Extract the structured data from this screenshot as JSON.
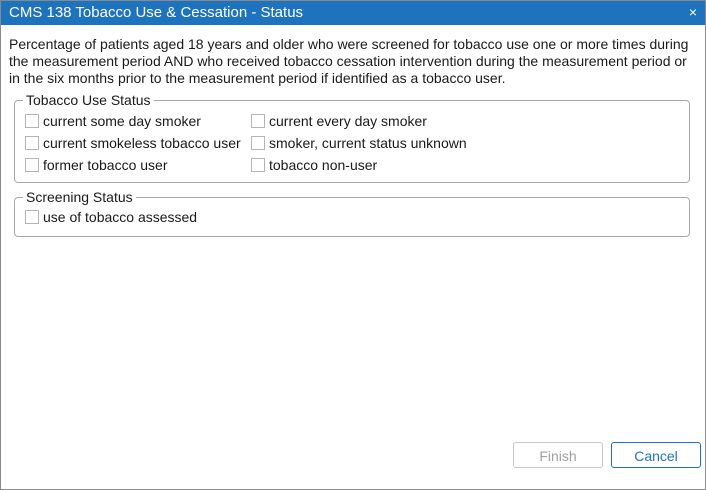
{
  "dialog": {
    "title": "CMS 138 Tobacco Use & Cessation - Status",
    "close_glyph": "×",
    "description": "Percentage of patients aged 18 years and older who were screened for tobacco use one or more times during the measurement period AND who received tobacco cessation intervention during the measurement period or in the six months prior to the measurement period if identified as a tobacco user."
  },
  "tobacco_use_status": {
    "legend": "Tobacco Use Status",
    "options": [
      {
        "label": "current some day smoker",
        "checked": false
      },
      {
        "label": "current every day smoker",
        "checked": false
      },
      {
        "label": "current smokeless tobacco user",
        "checked": false
      },
      {
        "label": "smoker, current status unknown",
        "checked": false
      },
      {
        "label": "former tobacco user",
        "checked": false
      },
      {
        "label": "tobacco non-user",
        "checked": false
      }
    ]
  },
  "screening_status": {
    "legend": "Screening Status",
    "options": [
      {
        "label": "use of tobacco assessed",
        "checked": false
      }
    ]
  },
  "footer": {
    "finish_label": "Finish",
    "finish_enabled": false,
    "cancel_label": "Cancel"
  },
  "colors": {
    "titlebar": "#1e73be",
    "accent": "#1e73be",
    "disabled_text": "#a0a0a0"
  }
}
